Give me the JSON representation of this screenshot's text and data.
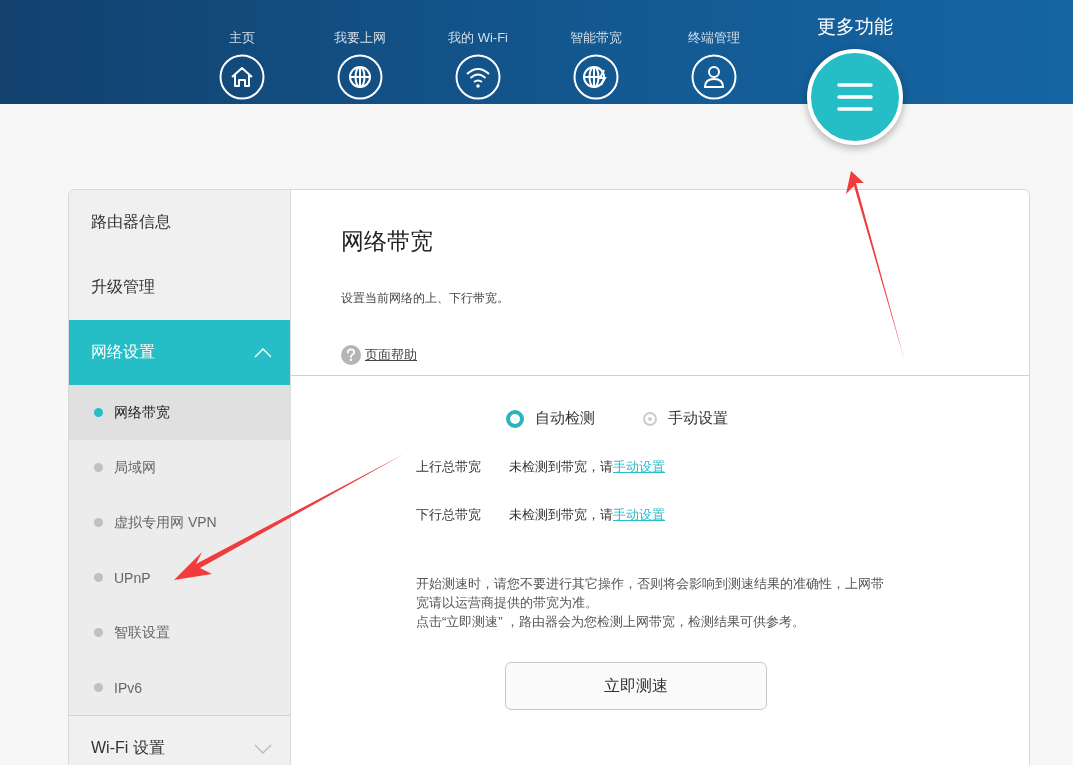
{
  "nav": {
    "items": [
      {
        "label": "主页"
      },
      {
        "label": "我要上网"
      },
      {
        "label": "我的 Wi-Fi"
      },
      {
        "label": "智能带宽"
      },
      {
        "label": "终端管理"
      }
    ],
    "more": {
      "label": "更多功能"
    }
  },
  "sidebar": {
    "items": [
      {
        "kind": "link",
        "label": "路由器信息",
        "selected": false
      },
      {
        "kind": "link",
        "label": "升级管理",
        "selected": false
      },
      {
        "kind": "group",
        "label": "网络设置",
        "selected": true,
        "expanded": true,
        "children": [
          {
            "label": "网络带宽",
            "selected": true
          },
          {
            "label": "局域网",
            "selected": false
          },
          {
            "label": "虚拟专用网 VPN",
            "selected": false
          },
          {
            "label": "UPnP",
            "selected": false
          },
          {
            "label": "智联设置",
            "selected": false
          },
          {
            "label": "IPv6",
            "selected": false
          }
        ]
      },
      {
        "kind": "group",
        "label": "Wi-Fi 设置",
        "selected": false,
        "expanded": false
      }
    ]
  },
  "panel": {
    "title": "网络带宽",
    "description": "设置当前网络的上、下行带宽。",
    "help_link": "页面帮助",
    "modes": [
      {
        "label": "自动检测",
        "selected": true
      },
      {
        "label": "手动设置",
        "selected": false
      }
    ],
    "rows": [
      {
        "label": "上行总带宽",
        "status": "未检测到带宽，请",
        "link": "手动设置"
      },
      {
        "label": "下行总带宽",
        "status": "未检测到带宽，请",
        "link": "手动设置"
      }
    ],
    "notes": [
      "开始测速时，请您不要进行其它操作，否则将会影响到测速结果的准确性，上网带宽请以运营商提供的带宽为准。",
      "点击“立即测速” ，路由器会为您检测上网带宽，检测结果可供参考。"
    ],
    "button": "立即测速"
  }
}
